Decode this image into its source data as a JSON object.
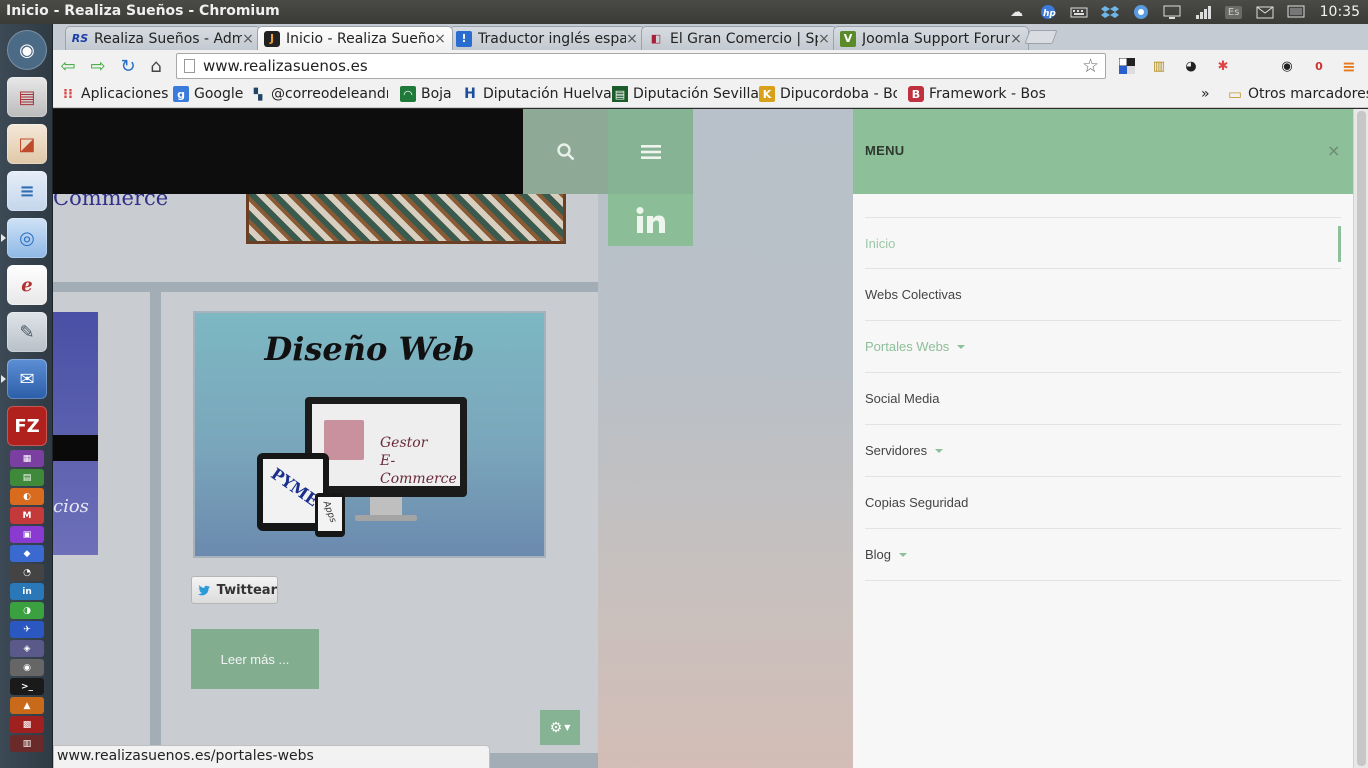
{
  "window": {
    "title": "Inicio - Realiza Sueños - Chromium"
  },
  "system_tray": {
    "keyboard_layout": "Es",
    "clock": "10:35"
  },
  "launcher": {
    "items": [
      {
        "icon": "ubuntu-home-icon",
        "color": "#4b6a86"
      },
      {
        "icon": "file-cabinet-icon",
        "color": "#a8323a"
      },
      {
        "icon": "presentation-icon",
        "color": "#c04b2a"
      },
      {
        "icon": "writer-document-icon",
        "color": "#2f6db5"
      },
      {
        "icon": "chromium-icon",
        "color": "#4a90d9"
      },
      {
        "icon": "eclipse-icon",
        "color": "#b23232"
      },
      {
        "icon": "text-editor-icon",
        "color": "#4a5866"
      },
      {
        "icon": "thunderbird-icon",
        "color": "#2b5ea8"
      },
      {
        "icon": "filezilla-icon",
        "color": "#b0201c"
      }
    ]
  },
  "tabs": [
    {
      "label": "Realiza Sueños - Admi",
      "favicon": "RS",
      "active": false
    },
    {
      "label": "Inicio - Realiza Sueños",
      "favicon": "J",
      "active": true
    },
    {
      "label": "Traductor inglés espa",
      "favicon": "!",
      "active": false
    },
    {
      "label": "El Gran Comercio | Sp",
      "favicon": "◧",
      "active": false
    },
    {
      "label": "Joomla Support Forum",
      "favicon": "V",
      "active": false
    }
  ],
  "omnibox": {
    "url": "www.realizasuenos.es"
  },
  "bookmarks": [
    {
      "label": "Aplicaciones",
      "color": "#d44"
    },
    {
      "label": "Google",
      "color": "#3b7bdc"
    },
    {
      "label": "@correodeleandro",
      "color": "#246"
    },
    {
      "label": "Boja",
      "color": "#1f7a3a"
    },
    {
      "label": "Diputación Huelva",
      "color": "#1b4f9c"
    },
    {
      "label": "Diputación Sevilla",
      "color": "#1c5b2a"
    },
    {
      "label": "Dipucordoba - Bop",
      "color": "#d9a11b"
    },
    {
      "label": "Framework - Bosst",
      "color": "#c0313f"
    }
  ],
  "bookmarks_overflow": "»",
  "other_bookmarks": "Otros marcadores",
  "page": {
    "ecommerce_fragment": "Commerce",
    "side_fragment": "cios",
    "diseno_title": "Diseño Web",
    "monitor_text": [
      "Gestor",
      "E-Commerce"
    ],
    "tablet_text": "PYMES",
    "phone_text": "Apps",
    "twitter_label": "Twittear",
    "read_more": "Leer más ...",
    "menu": {
      "title": "MENU",
      "close": "×",
      "items": [
        {
          "label": "Inicio",
          "active": true,
          "has_submenu": false
        },
        {
          "label": "Webs Colectivas",
          "active": false,
          "has_submenu": false
        },
        {
          "label": "Portales Webs",
          "active": false,
          "has_submenu": true
        },
        {
          "label": "Social Media",
          "active": false,
          "has_submenu": false
        },
        {
          "label": "Servidores",
          "active": false,
          "has_submenu": true
        },
        {
          "label": "Copias Seguridad",
          "active": false,
          "has_submenu": false
        },
        {
          "label": "Blog",
          "active": false,
          "has_submenu": true
        }
      ]
    }
  },
  "status_url": "www.realizasuenos.es/portales-webs",
  "colors": {
    "accent_green": "#8dbf99",
    "header_black": "#0d0d0d"
  }
}
